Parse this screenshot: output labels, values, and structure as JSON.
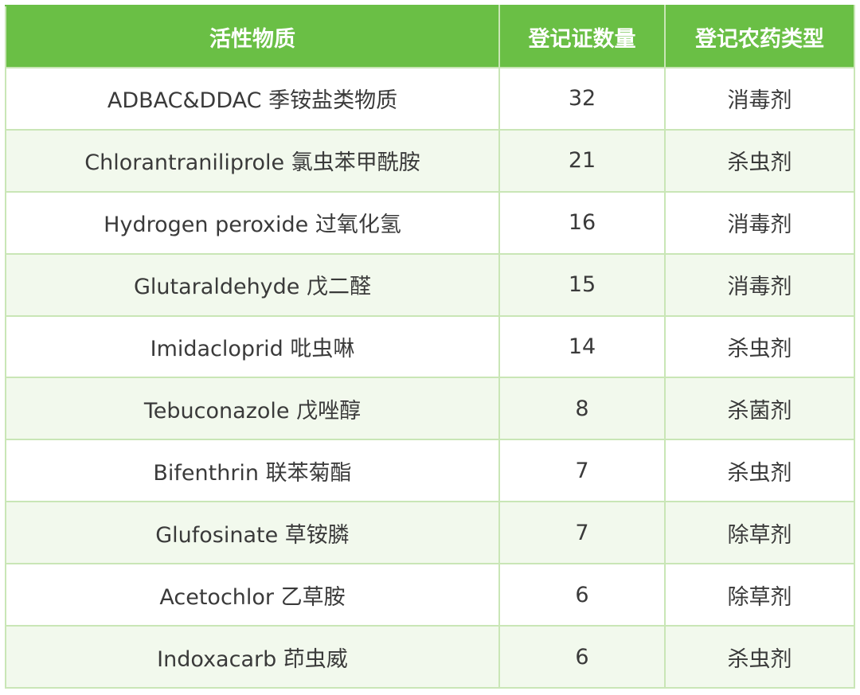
{
  "table": {
    "headers": [
      "活性物质",
      "登记证数量",
      "登记农药类型"
    ],
    "rows": [
      [
        "ADBAC&DDAC 季铵盐类物质",
        "32",
        "消毒剂"
      ],
      [
        "Chlorantraniliprole 氯虫苯甲酰胺",
        "21",
        "杀虫剂"
      ],
      [
        "Hydrogen peroxide 过氧化氢",
        "16",
        "消毒剂"
      ],
      [
        "Glutaraldehyde 戊二醛",
        "15",
        "消毒剂"
      ],
      [
        "Imidacloprid 吡虫啉",
        "14",
        "杀虫剂"
      ],
      [
        "Tebuconazole 戊唑醇",
        "8",
        "杀菌剂"
      ],
      [
        "Bifenthrin 联苯菊酯",
        "7",
        "杀虫剂"
      ],
      [
        "Glufosinate 草铵膦",
        "7",
        "除草剂"
      ],
      [
        "Acetochlor 乙草胺",
        "6",
        "除草剂"
      ],
      [
        "Indoxacarb 茚虫威",
        "6",
        "杀虫剂"
      ]
    ]
  },
  "colors": {
    "header_bg": "#6abf45",
    "header_text": "#ffffff",
    "border": "#c9e6b6",
    "row_alt_bg": "#f2f9ed",
    "body_text": "#3a3a3a"
  }
}
